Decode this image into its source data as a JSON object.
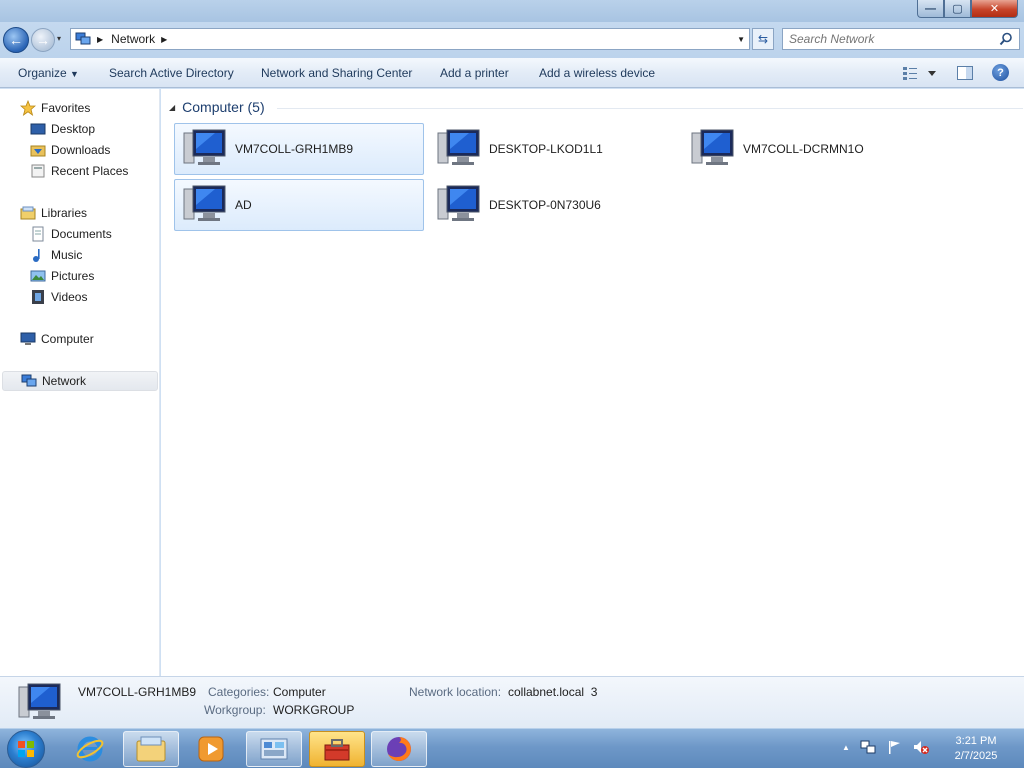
{
  "window": {
    "buttons": {
      "minimize": "—",
      "maximize": "▢",
      "close": "✕"
    }
  },
  "address": {
    "crumb": "Network",
    "search_placeholder": "Search Network"
  },
  "toolbar": {
    "organize": "Organize",
    "search_ad": "Search Active Directory",
    "sharing_center": "Network and Sharing Center",
    "add_printer": "Add a printer",
    "add_wireless": "Add a wireless device",
    "help": "?"
  },
  "navpane": {
    "favorites": "Favorites",
    "desktop": "Desktop",
    "downloads": "Downloads",
    "recent_places": "Recent Places",
    "libraries": "Libraries",
    "documents": "Documents",
    "music": "Music",
    "pictures": "Pictures",
    "videos": "Videos",
    "computer": "Computer",
    "network": "Network"
  },
  "content": {
    "group_header": "Computer (5)",
    "computers": [
      {
        "name": "VM7COLL-GRH1MB9",
        "selected": true
      },
      {
        "name": "DESKTOP-LKOD1L1",
        "selected": false
      },
      {
        "name": "VM7COLL-DCRMN1O",
        "selected": false
      },
      {
        "name": "AD",
        "selected": true
      },
      {
        "name": "DESKTOP-0N730U6",
        "selected": false
      }
    ]
  },
  "details": {
    "name": "VM7COLL-GRH1MB9",
    "categories_label": "Categories:",
    "categories_value": "Computer",
    "network_location_label": "Network location:",
    "network_location_value": "collabnet.local  3",
    "workgroup_label": "Workgroup:",
    "workgroup_value": "WORKGROUP"
  },
  "taskbar": {
    "time": "3:21 PM",
    "date": "2/7/2025"
  },
  "colors": {
    "accent": "#1e395b",
    "selection_border": "#9fc3ea",
    "taskbar": "#6e98c8"
  },
  "icons": [
    "back-arrow-icon",
    "forward-arrow-icon",
    "network-icon",
    "refresh-icon",
    "search-icon",
    "view-icon",
    "preview-pane-icon",
    "help-icon",
    "star-icon",
    "desktop-icon",
    "downloads-icon",
    "recent-places-icon",
    "libraries-icon",
    "documents-icon",
    "music-icon",
    "pictures-icon",
    "videos-icon",
    "computer-icon",
    "ie-icon",
    "explorer-icon",
    "media-player-icon",
    "control-panel-icon",
    "toolbox-icon",
    "firefox-icon",
    "flag-icon",
    "speaker-muted-icon"
  ]
}
